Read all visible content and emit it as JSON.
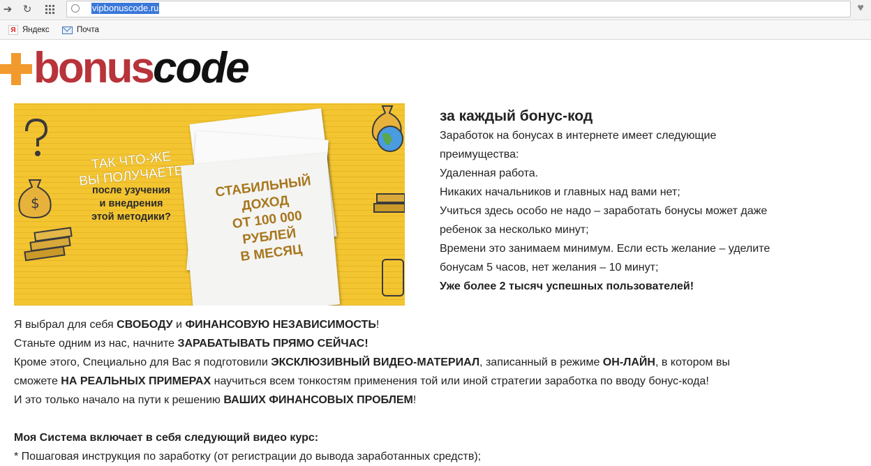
{
  "browser": {
    "url": "vipbonuscode.ru",
    "bookmarks": [
      {
        "label": "Яндекс",
        "icon": "yandex-icon"
      },
      {
        "label": "Почта",
        "icon": "mail-icon"
      }
    ]
  },
  "logo": {
    "part1": "bonus",
    "part2": "code",
    "accent_color": "#f29a2e",
    "bonus_color": "#b8333a"
  },
  "banner": {
    "big_line1": "ТАК ЧТО-ЖЕ",
    "big_line2": "ВЫ ПОЛУЧАЕТЕ",
    "small_line1": "после узучения",
    "small_line2": "и внедрения",
    "small_line3": "этой методики?",
    "paper_line1": "СТАБИЛЬНЫЙ",
    "paper_line2": "ДОХОД",
    "paper_line3": "ОТ 100 000",
    "paper_line4": "РУБЛЕЙ",
    "paper_line5": "В МЕСЯЦ"
  },
  "right": {
    "heading": "за каждый бонус-код",
    "lines": [
      "Заработок на бонусах в интернете имеет следующие",
      "преимущества:",
      "Удаленная работа.",
      "Никаких начальников и главных над вами нет;",
      "Учиться здесь особо не надо – заработать бонусы может даже",
      "ребенок за несколько минут;",
      "Времени это занимаем минимум. Если есть желание – уделите",
      "бонусам 5 часов, нет желания – 10 минут;"
    ],
    "bold_line": "Уже более 2 тысяч успешных пользователей!"
  },
  "body": {
    "l1_a": "Я выбрал для себя ",
    "l1_b": "СВОБОДУ",
    "l1_c": " и ",
    "l1_d": "ФИНАНСОВУЮ НЕЗАВИСИМОСТЬ",
    "l1_e": "!",
    "l2_a": "Станьте одним из нас, начните ",
    "l2_b": "ЗАРАБАТЫВАТЬ ПРЯМО СЕЙЧАС!",
    "l3_a": "Кроме этого, Специально для Вас я подготовили ",
    "l3_b": "ЭКСКЛЮЗИВНЫЙ ВИДЕО-МАТЕРИАЛ",
    "l3_c": ", записанный в режиме ",
    "l3_d": "ОН-ЛАЙН",
    "l3_e": ", в котором вы",
    "l4_a": "сможете ",
    "l4_b": "НА РЕАЛЬНЫХ ПРИМЕРАХ",
    "l4_c": " научиться всем тонкостям применения той или иной стратегии заработка по вводу бонус-кода!",
    "l5_a": "И это только начало на пути к решению ",
    "l5_b": "ВАШИХ ФИНАНСОВЫХ ПРОБЛЕМ",
    "l5_c": "!",
    "system_heading": "Моя Система включает в себя следующий видео курс:",
    "item1": "* Пошаговая инструкция по заработку (от регистрации до вывода заработанных средств);"
  }
}
